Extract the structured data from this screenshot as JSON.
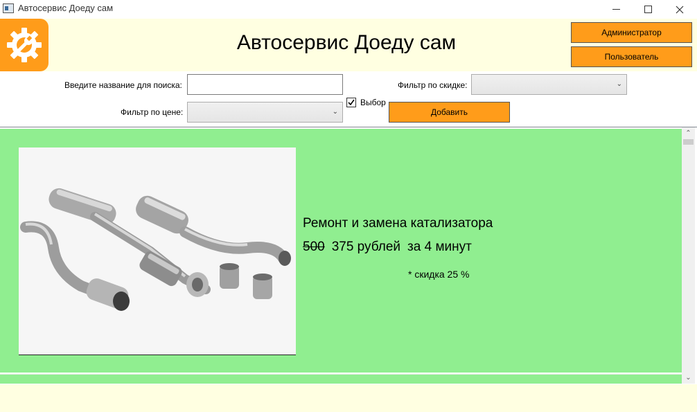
{
  "window": {
    "title": "Автосервис Доеду сам",
    "controls": {
      "minimize": "minimize-icon",
      "maximize": "maximize-icon",
      "close": "close-icon"
    }
  },
  "header": {
    "logo_icon": "gear-wrench-icon",
    "title": "Автосервис Доеду сам",
    "admin_button": "Администратор",
    "user_button": "Пользователь"
  },
  "filters": {
    "search_label": "Введите название для поиска:",
    "search_value": "",
    "price_label": "Фильтр по цене:",
    "price_selected": "",
    "discount_label": "Фильтр по скидке:",
    "discount_selected": "",
    "checkbox_label": "Выбор",
    "checkbox_checked": true,
    "add_button": "Добавить"
  },
  "services": [
    {
      "image_icon": "exhaust-system-photo",
      "title": "Ремонт и замена катализатора",
      "old_price": "500",
      "new_price": "375 рублей",
      "duration": "за 4 минут",
      "discount": "* скидка 25 %"
    }
  ],
  "colors": {
    "accent": "#FF9C1A",
    "header_bg": "#FFFFE1",
    "discount_card_bg": "#90EE90"
  }
}
